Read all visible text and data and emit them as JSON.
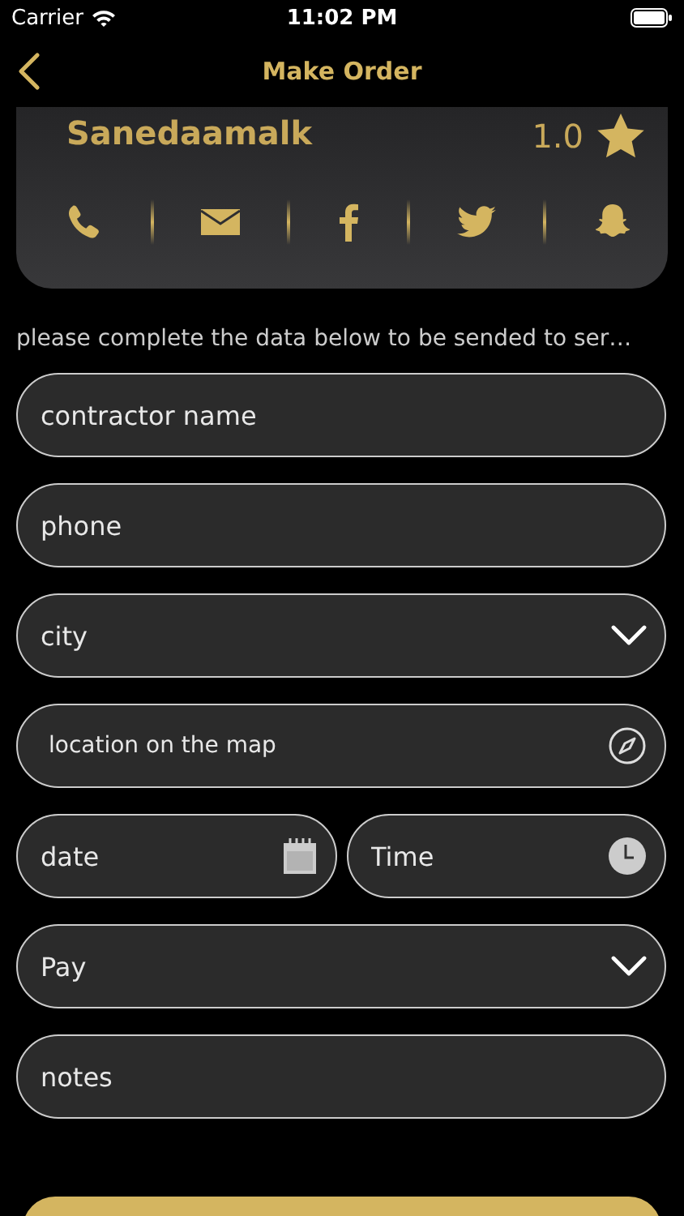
{
  "status_bar": {
    "carrier": "Carrier",
    "time": "11:02 PM"
  },
  "nav": {
    "title": "Make Order"
  },
  "provider": {
    "name": "Sanedaamalk",
    "rating": "1.0"
  },
  "instructions": "please complete the data below to be sended to ser…",
  "rows": [
    {
      "fields": [
        {
          "kind": "text",
          "placeholder": "contractor name"
        }
      ]
    },
    {
      "fields": [
        {
          "kind": "text",
          "placeholder": "phone"
        }
      ]
    },
    {
      "fields": [
        {
          "kind": "select",
          "placeholder": "city"
        }
      ]
    },
    {
      "fields": [
        {
          "kind": "map",
          "placeholder": "location on the map"
        }
      ]
    },
    {
      "fields": [
        {
          "kind": "date",
          "placeholder": "date"
        },
        {
          "kind": "time",
          "placeholder": "Time"
        }
      ]
    },
    {
      "fields": [
        {
          "kind": "select",
          "placeholder": "Pay"
        }
      ]
    },
    {
      "fields": [
        {
          "kind": "text",
          "placeholder": "notes"
        }
      ]
    }
  ]
}
